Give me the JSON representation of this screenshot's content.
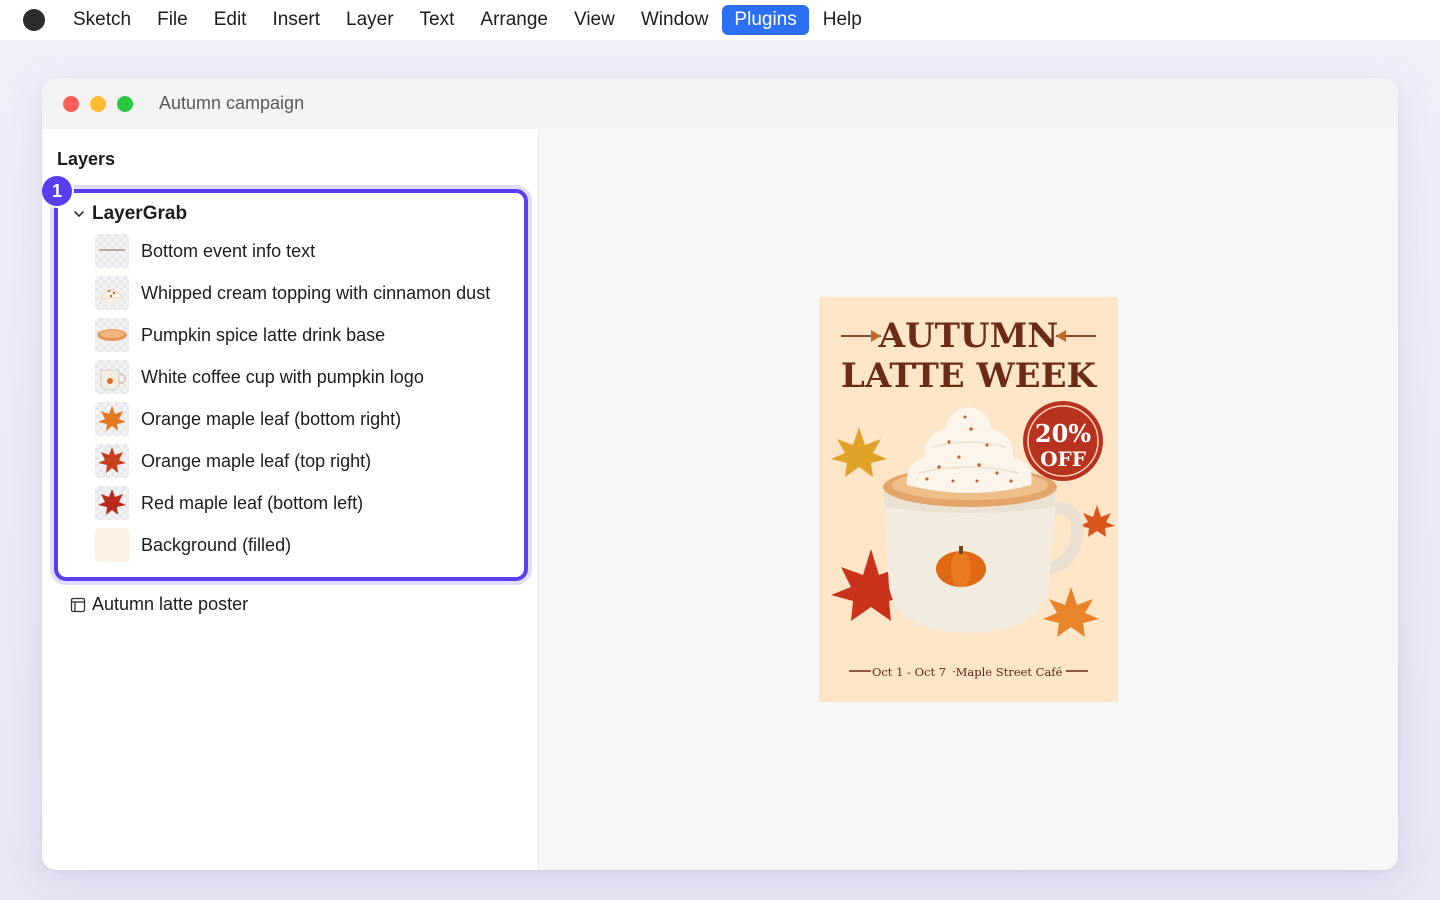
{
  "menubar": {
    "items": [
      "Sketch",
      "File",
      "Edit",
      "Insert",
      "Layer",
      "Text",
      "Arrange",
      "View",
      "Window",
      "Plugins",
      "Help"
    ],
    "active": "Plugins"
  },
  "window": {
    "title": "Autumn campaign"
  },
  "sidebar": {
    "heading": "Layers",
    "badge": "1",
    "group": {
      "label": "LayerGrab",
      "layers": [
        {
          "label": "Bottom event info text",
          "icon": "text-thumb"
        },
        {
          "label": "Whipped cream topping with cinnamon dust",
          "icon": "whipped-cream-thumb"
        },
        {
          "label": "Pumpkin spice latte drink base",
          "icon": "latte-base-thumb"
        },
        {
          "label": "White coffee cup with pumpkin logo",
          "icon": "coffee-cup-thumb"
        },
        {
          "label": "Orange maple leaf (bottom right)",
          "icon": "orange-leaf-thumb"
        },
        {
          "label": "Orange maple leaf (top right)",
          "icon": "orange-leaf-thumb"
        },
        {
          "label": "Red maple leaf (bottom left)",
          "icon": "red-leaf-thumb"
        },
        {
          "label": "Background (filled)",
          "icon": "background-thumb"
        }
      ]
    },
    "artboard": {
      "label": "Autumn latte poster"
    }
  },
  "poster": {
    "title_line1": "AUTUMN",
    "title_line2": "LATTE WEEK",
    "discount_pct": "20%",
    "discount_off": "OFF",
    "footer_dates": "Oct 1 - Oct 7",
    "footer_sep": "·",
    "footer_place": "Maple Street Café"
  },
  "colors": {
    "accent": "#2c6ff2",
    "highlight": "#5b3df0",
    "poster_bg": "#fde5c8",
    "poster_title": "#6b2b14",
    "badge_red": "#b8321f"
  }
}
